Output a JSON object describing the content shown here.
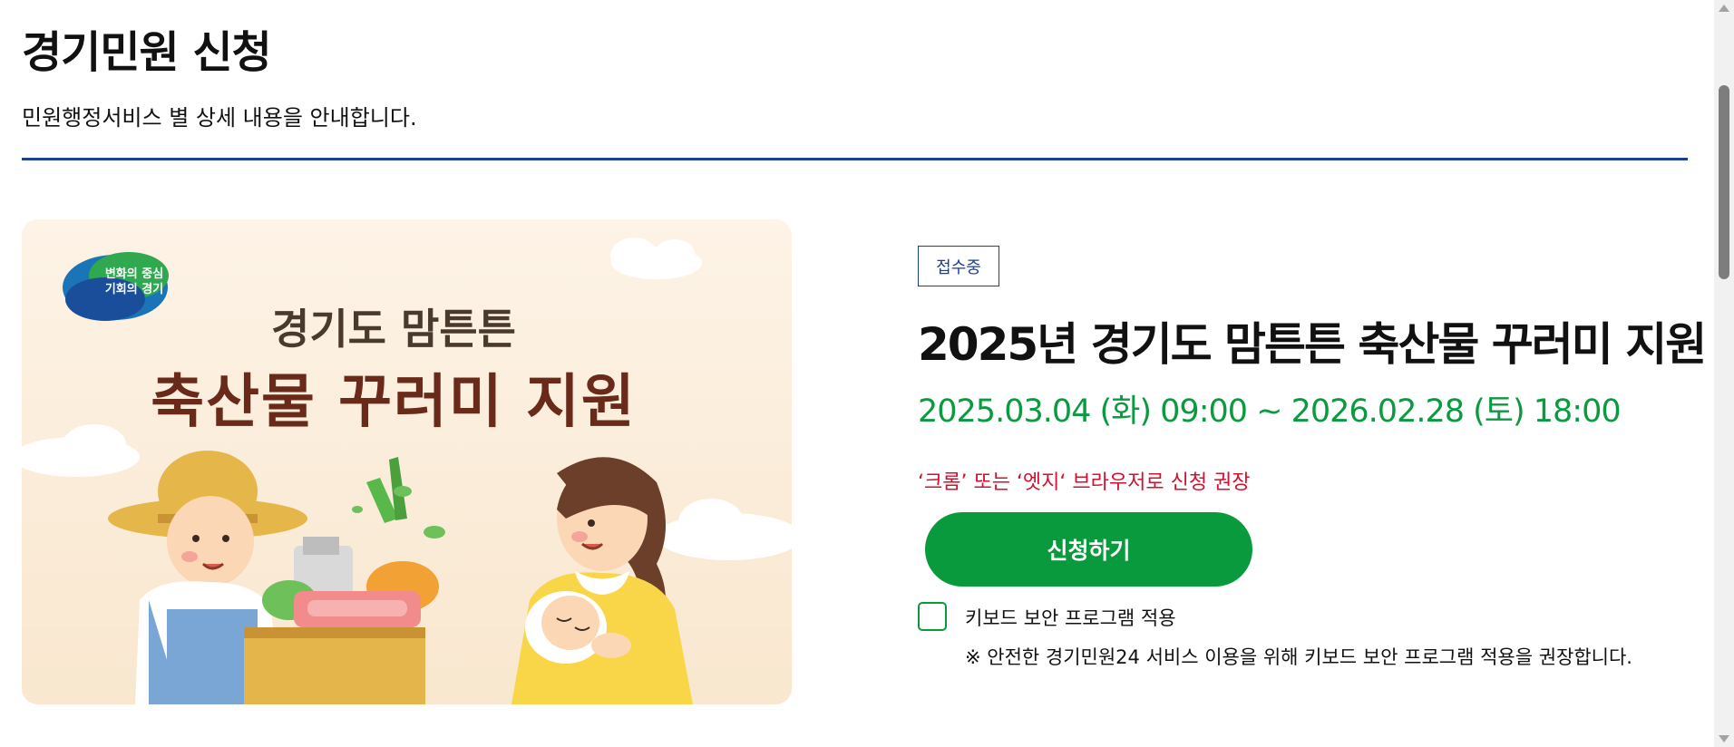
{
  "page": {
    "title": "경기민원 신청",
    "subtitle": "민원행정서비스 별 상세 내용을 안내합니다."
  },
  "banner": {
    "logo_line1": "변화의 중심",
    "logo_line2": "기회의 경기",
    "headline_small": "경기도 맘튼튼",
    "headline_large": "축산물 꾸러미 지원"
  },
  "service": {
    "status": "접수중",
    "title": "2025년 경기도 맘튼튼 축산물 꾸러미 지원",
    "period": "2025.03.04 (화) 09:00 ~ 2026.02.28 (토) 18:00",
    "browser_note": "‘크롬’ 또는 ‘엣지‘ 브라우저로 신청 권장",
    "apply_label": "신청하기",
    "keyboard_security_label": "키보드 보안 프로그램 적용",
    "keyboard_security_checked": false,
    "security_note": "※ 안전한 경기민원24 서비스 이용을 위해 키보드 보안 프로그램 적용을 권장합니다."
  },
  "colors": {
    "accent_blue": "#1a3f93",
    "accent_green": "#0a9a3e",
    "warning_red": "#d3102f"
  }
}
